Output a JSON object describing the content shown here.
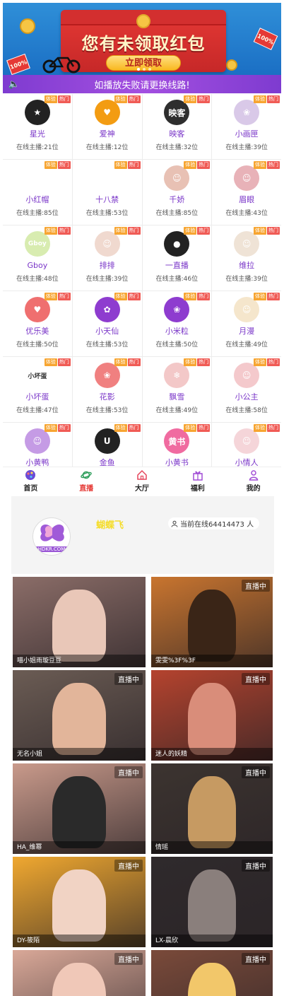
{
  "banner": {
    "headline": "您有未领取红包",
    "cta_label": "立即领取",
    "redbag_label": "100%",
    "colors": {
      "background": "#1b6fc4",
      "envelope": "#d32f2f",
      "text": "#fff5c8"
    }
  },
  "notice": {
    "text": "如播放失败请更换线路!",
    "icon": "speaker-icon"
  },
  "platforms": [
    {
      "name": "星光",
      "online": "在线主播:21位",
      "color": "#222222",
      "glyph": "★"
    },
    {
      "name": "爱神",
      "online": "在线主播:12位",
      "color": "#f39c12",
      "glyph": "♥"
    },
    {
      "name": "映客",
      "online": "在线主播:32位",
      "color": "#2e2e2e",
      "glyph": "映客"
    },
    {
      "name": "小画匣",
      "online": "在线主播:39位",
      "color": "#d9c9e8",
      "glyph": "❀"
    },
    {
      "name": "小红帽",
      "online": "在线主播:85位",
      "color": "#ffffff",
      "glyph": ""
    },
    {
      "name": "十八禁",
      "online": "在线主播:53位",
      "color": "#ffffff",
      "glyph": ""
    },
    {
      "name": "千娇",
      "online": "在线主播:85位",
      "color": "#e8c1b4",
      "glyph": "☺"
    },
    {
      "name": "眉眼",
      "online": "在线主播:43位",
      "color": "#e8b2b8",
      "glyph": "☺"
    },
    {
      "name": "Gboy",
      "online": "在线主播:48位",
      "color": "#d8ecb0",
      "glyph": "Gboy"
    },
    {
      "name": "排排",
      "online": "在线主播:39位",
      "color": "#f0d9cf",
      "glyph": "☺"
    },
    {
      "name": "一直播",
      "online": "在线主播:46位",
      "color": "#222222",
      "glyph": "●"
    },
    {
      "name": "维拉",
      "online": "在线主播:39位",
      "color": "#efe3d6",
      "glyph": "☺"
    },
    {
      "name": "优乐美",
      "online": "在线主播:50位",
      "color": "#ef6f6f",
      "glyph": "♥"
    },
    {
      "name": "小天仙",
      "online": "在线主播:53位",
      "color": "#8e3ccf",
      "glyph": "✿"
    },
    {
      "name": "小米粒",
      "online": "在线主播:50位",
      "color": "#8e3ccf",
      "glyph": "❀"
    },
    {
      "name": "月漫",
      "online": "在线主播:49位",
      "color": "#f5e6cc",
      "glyph": "☺"
    },
    {
      "name": "小坏蛋",
      "online": "在线主播:47位",
      "color": "#ffffff",
      "glyph": "小坏蛋"
    },
    {
      "name": "花影",
      "online": "在线主播:53位",
      "color": "#f08080",
      "glyph": "❀"
    },
    {
      "name": "飘雪",
      "online": "在线主播:49位",
      "color": "#f3c8c8",
      "glyph": "❄"
    },
    {
      "name": "小公主",
      "online": "在线主播:58位",
      "color": "#f4c9cc",
      "glyph": "☺"
    },
    {
      "name": "小黄鸭",
      "online": "",
      "color": "#c59be5",
      "glyph": "☺"
    },
    {
      "name": "金鱼",
      "online": "",
      "color": "#222222",
      "glyph": "U"
    },
    {
      "name": "小黄书",
      "online": "",
      "color": "#f06ba0",
      "glyph": "黄书"
    },
    {
      "name": "小情人",
      "online": "",
      "color": "#f5d5d9",
      "glyph": "☺"
    }
  ],
  "tags": {
    "t1": "体验",
    "t2": "热门"
  },
  "nav": [
    {
      "label": "首页",
      "icon": "home-ball-icon",
      "active": false
    },
    {
      "label": "直播",
      "icon": "planet-icon",
      "active": true
    },
    {
      "label": "大厅",
      "icon": "house-icon",
      "active": false
    },
    {
      "label": "福利",
      "icon": "gift-icon",
      "active": false
    },
    {
      "label": "我的",
      "icon": "user-icon",
      "active": false
    }
  ],
  "room": {
    "title": "蝴蝶飞",
    "site": "HDKR.COM",
    "online_label": "当前在线64414473 人",
    "live_label": "直播中",
    "streams": [
      {
        "caption": "喵小姐雨璇豆豆",
        "tone": "#8b6d68",
        "skin": "#e9c7b8"
      },
      {
        "caption": "雯雯%3F%3F",
        "tone": "#c9752f",
        "skin": "#3a2517"
      },
      {
        "caption": "无名小姐",
        "tone": "#6b5c54",
        "skin": "#e2b59a"
      },
      {
        "caption": "迷人的妖精",
        "tone": "#b5432e",
        "skin": "#d98d7a"
      },
      {
        "caption": "HA_维幂",
        "tone": "#c99a8b",
        "skin": "#2a2a2a"
      },
      {
        "caption": "情瑶",
        "tone": "#3c3430",
        "skin": "#c69a62"
      },
      {
        "caption": "DY-筱陌",
        "tone": "#f0a830",
        "skin": "#f1d3c4"
      },
      {
        "caption": "LX-晨欣",
        "tone": "#2f2a2c",
        "skin": "#8a7f7c"
      },
      {
        "caption": "",
        "tone": "#d9a898",
        "skin": "#f0c8b8"
      },
      {
        "caption": "",
        "tone": "#7a4a3a",
        "skin": "#f2c76a"
      }
    ]
  }
}
